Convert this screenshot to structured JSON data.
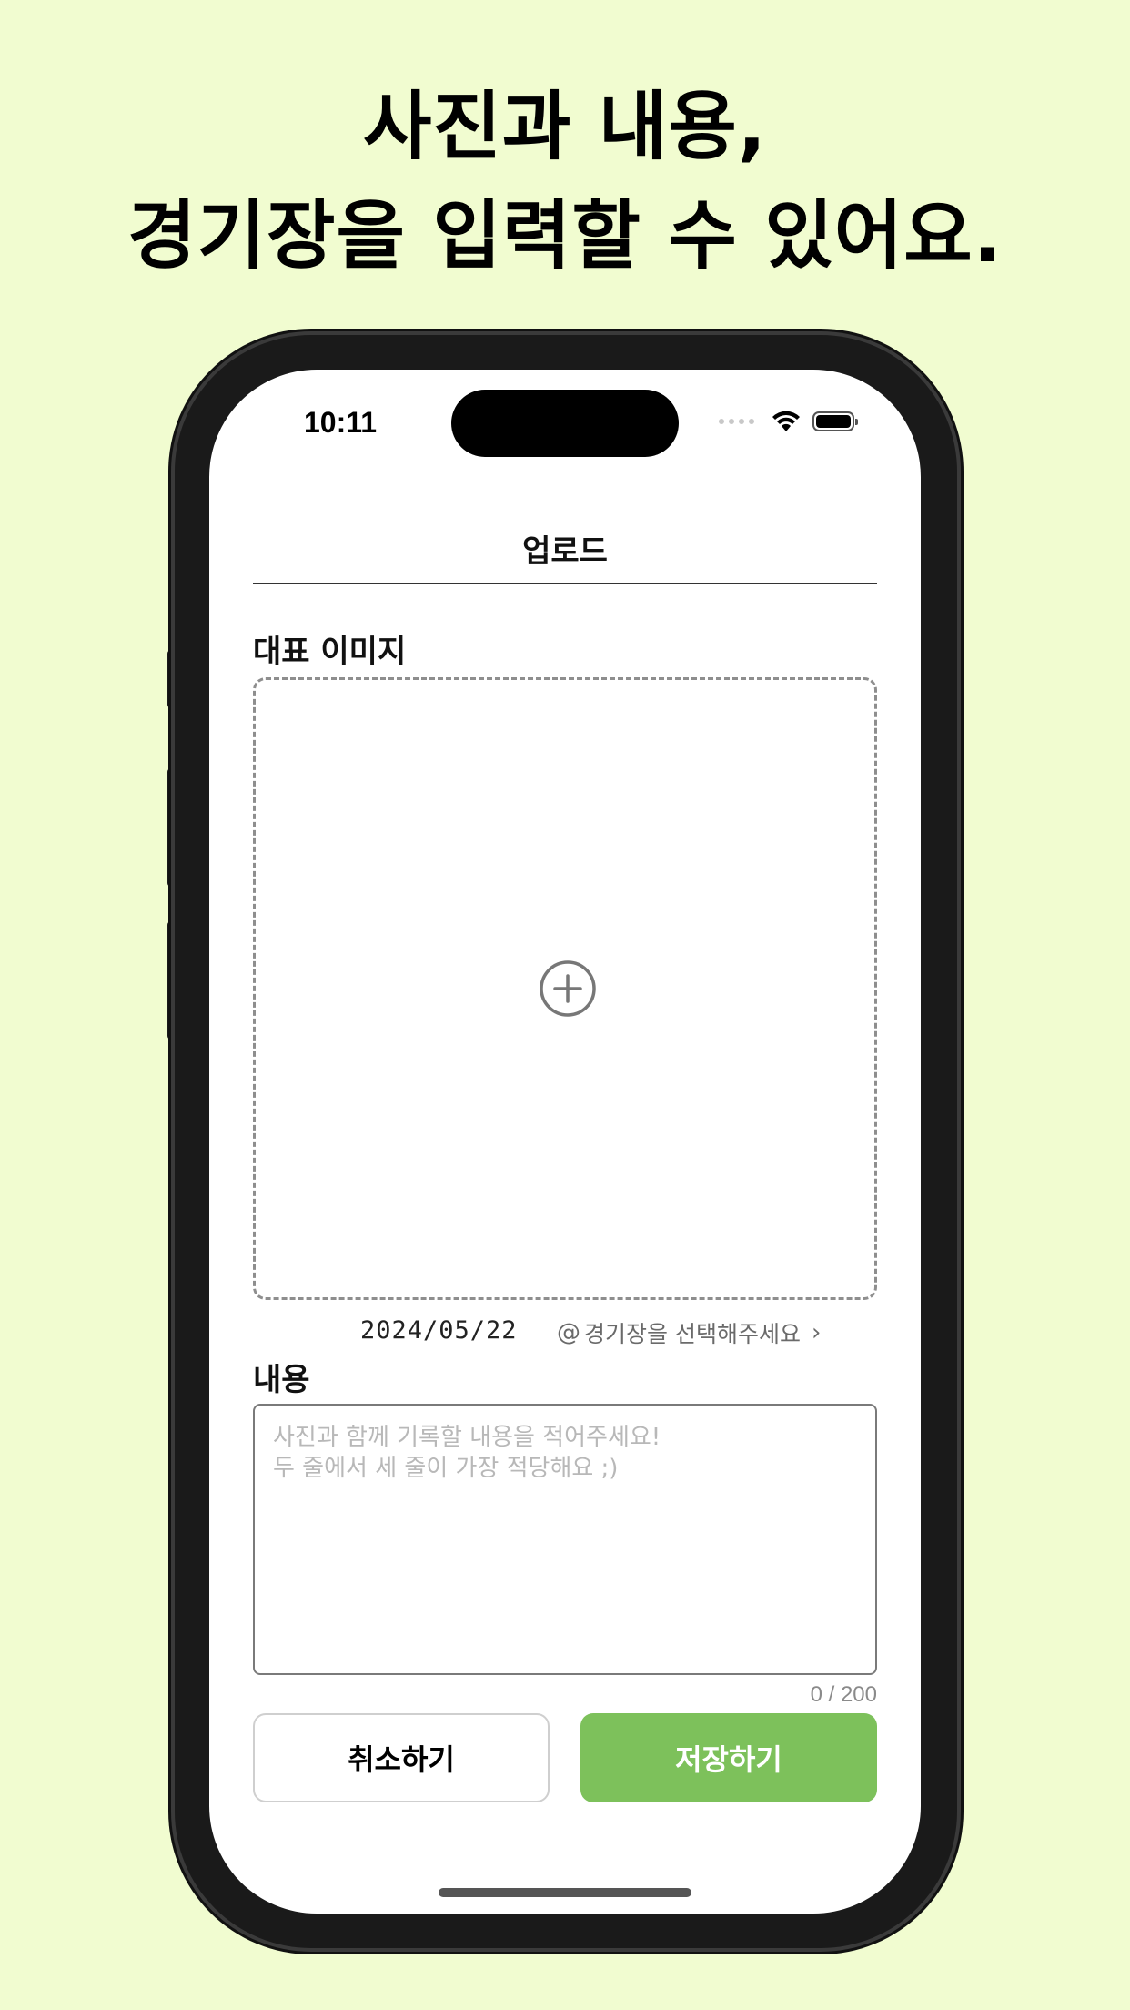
{
  "headline": {
    "line1": "사진과 내용,",
    "line2": "경기장을 입력할 수 있어요."
  },
  "status_bar": {
    "time": "10:11",
    "icons": [
      "cellular-dots-icon",
      "wifi-icon",
      "battery-icon"
    ]
  },
  "nav": {
    "title": "업로드"
  },
  "image_section": {
    "label": "대표 이미지",
    "add_icon": "plus-circle-icon"
  },
  "meta": {
    "date": "2024/05/22",
    "stadium_prefix_icon": "at-icon",
    "stadium_placeholder": "경기장을 선택해주세요",
    "chevron": "›"
  },
  "content_section": {
    "label": "내용",
    "placeholder_line1": "사진과 함께 기록할 내용을 적어주세요!",
    "placeholder_line2": "두 줄에서 세 줄이 가장 적당해요 ;)",
    "counter": "0 / 200"
  },
  "buttons": {
    "cancel": "취소하기",
    "save": "저장하기"
  },
  "colors": {
    "background": "#f1fcd0",
    "accent": "#7dc15b"
  }
}
